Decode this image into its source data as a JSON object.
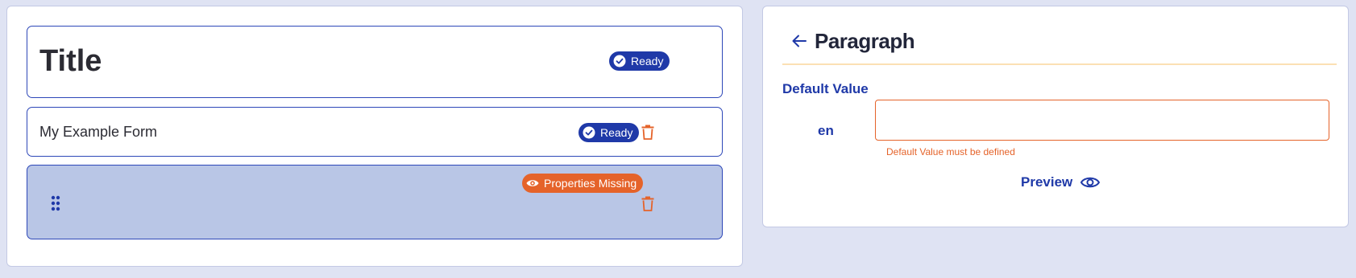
{
  "form_builder": {
    "title_card": {
      "text": "Title",
      "badge": "Ready"
    },
    "form_card": {
      "text": "My Example Form",
      "badge": "Ready"
    },
    "selected_card": {
      "badge": "Properties Missing"
    }
  },
  "properties_panel": {
    "title": "Paragraph",
    "section_label": "Default Value",
    "language": "en",
    "input_value": "",
    "error": "Default Value must be defined",
    "preview_label": "Preview"
  },
  "colors": {
    "accent": "#1f39a8",
    "warning": "#e5632a",
    "selected_bg": "#b9c6e6",
    "page_bg": "#dfe3f3"
  },
  "icons": {
    "ready": "check-circle-icon",
    "missing": "eye-icon",
    "delete": "trash-icon",
    "drag": "drag-handle-icon",
    "back": "arrow-left-icon",
    "preview": "eye-icon"
  }
}
